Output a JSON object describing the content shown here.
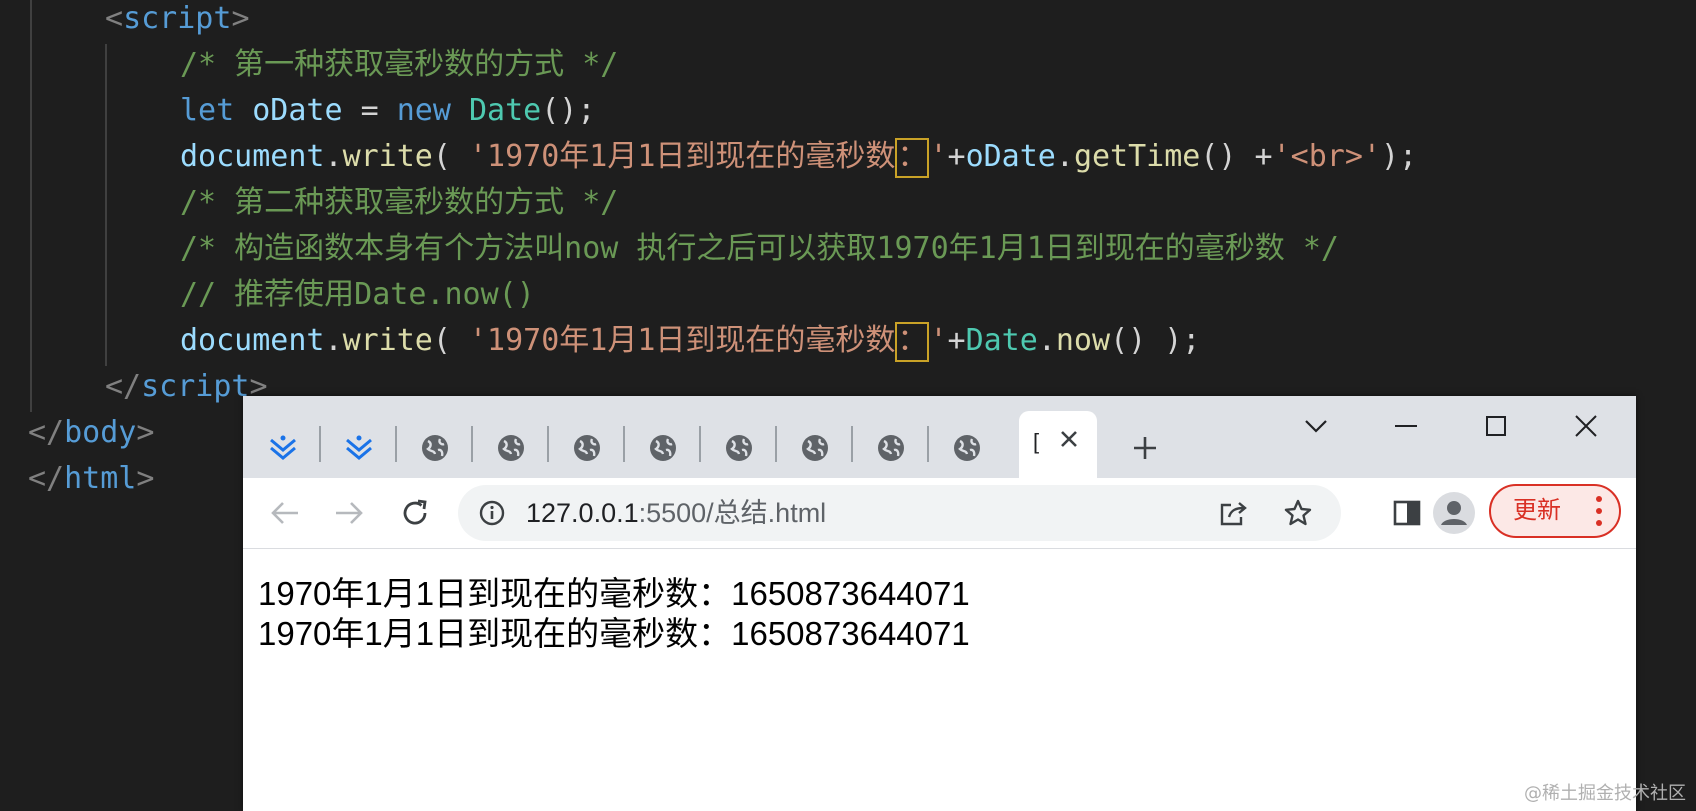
{
  "editor": {
    "lines": [
      {
        "parts": [
          [
            "punc",
            "<"
          ],
          [
            "tag",
            "script"
          ],
          [
            "punc",
            ">"
          ]
        ]
      },
      {
        "parts": [
          [
            "comment",
            "/* 第一种获取毫秒数的方式 */"
          ]
        ]
      },
      {
        "parts": [
          [
            "kw",
            "let"
          ],
          [
            "op",
            " "
          ],
          [
            "var",
            "oDate"
          ],
          [
            "op",
            " = "
          ],
          [
            "kw",
            "new"
          ],
          [
            "op",
            " "
          ],
          [
            "class",
            "Date"
          ],
          [
            "op",
            "();"
          ]
        ]
      },
      {
        "parts": [
          [
            "var",
            "document"
          ],
          [
            "op",
            "."
          ],
          [
            "fn",
            "write"
          ],
          [
            "op",
            "( "
          ],
          [
            "str",
            "'1970年1月1日到现在的毫秒数"
          ],
          [
            "box",
            "："
          ],
          [
            "str",
            "'"
          ],
          [
            "op",
            "+"
          ],
          [
            "var",
            "oDate"
          ],
          [
            "op",
            "."
          ],
          [
            "fn",
            "getTime"
          ],
          [
            "op",
            "() +"
          ],
          [
            "str",
            "'<br>'"
          ],
          [
            "op",
            ");"
          ]
        ]
      },
      {
        "parts": [
          [
            "comment",
            "/* 第二种获取毫秒数的方式 */"
          ]
        ]
      },
      {
        "parts": [
          [
            "comment",
            "/* 构造函数本身有个方法叫now 执行之后可以获取1970年1月1日到现在的毫秒数 */"
          ]
        ]
      },
      {
        "parts": [
          [
            "comment",
            "// 推荐使用Date.now()"
          ]
        ]
      },
      {
        "parts": [
          [
            "var",
            "document"
          ],
          [
            "op",
            "."
          ],
          [
            "fn",
            "write"
          ],
          [
            "op",
            "( "
          ],
          [
            "str",
            "'1970年1月1日到现在的毫秒数"
          ],
          [
            "box",
            "："
          ],
          [
            "str",
            "'"
          ],
          [
            "op",
            "+"
          ],
          [
            "class",
            "Date"
          ],
          [
            "op",
            "."
          ],
          [
            "fn",
            "now"
          ],
          [
            "op",
            "() );"
          ]
        ]
      },
      {
        "parts": [
          [
            "punc",
            "</"
          ],
          [
            "tag",
            "script"
          ],
          [
            "punc",
            ">"
          ]
        ]
      },
      {
        "parts": [
          [
            "punc",
            "</"
          ],
          [
            "tag",
            "body"
          ],
          [
            "punc",
            ">"
          ]
        ]
      },
      {
        "parts": [
          [
            "punc",
            "</"
          ],
          [
            "tag",
            "html"
          ],
          [
            "punc",
            ">"
          ]
        ]
      }
    ]
  },
  "browser": {
    "tabs": [
      "tab-icon-1",
      "tab-icon-2",
      "globe-icon",
      "globe-icon",
      "globe-icon",
      "globe-icon",
      "globe-icon",
      "globe-icon",
      "globe-icon",
      "globe-icon"
    ],
    "active_tab_text": "[",
    "url_host": "127.0.0.1",
    "url_rest": ":5500/总结.html",
    "update_label": "更新",
    "accent": "#d93025",
    "content_lines": [
      "1970年1月1日到现在的毫秒数：1650873644071",
      "1970年1月1日到现在的毫秒数：1650873644071"
    ]
  },
  "watermark": "@稀土掘金技术社区"
}
